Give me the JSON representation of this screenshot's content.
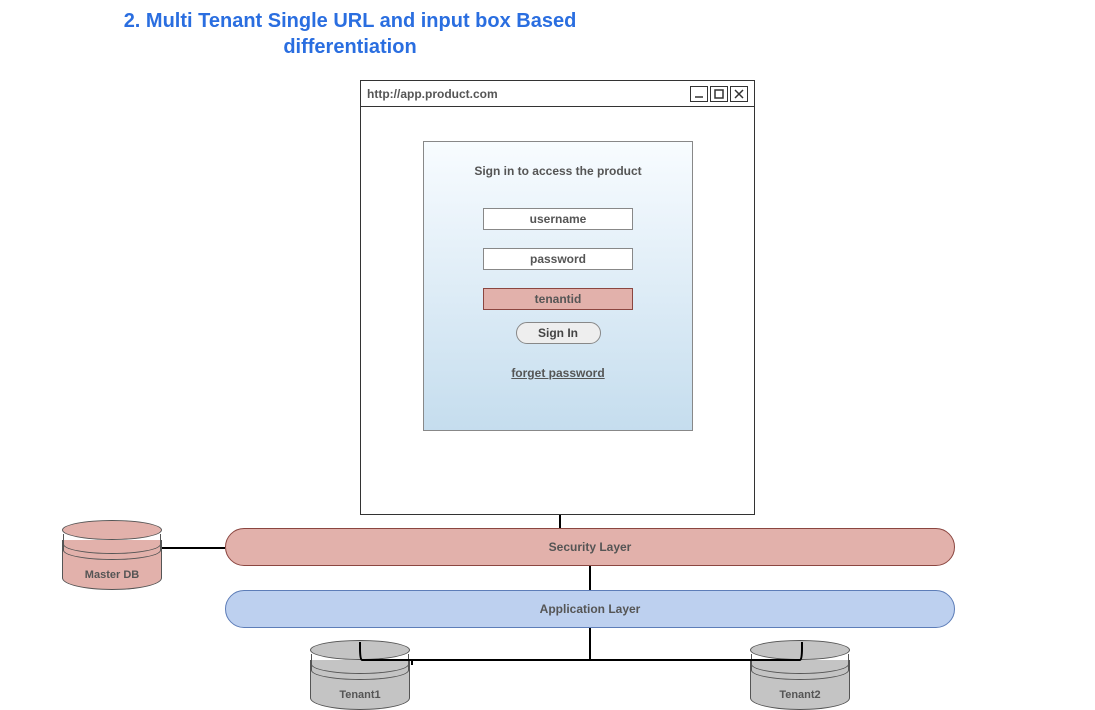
{
  "title": "2. Multi Tenant Single URL and input box Based differentiation",
  "browser": {
    "url": "http://app.product.com"
  },
  "login": {
    "heading": "Sign in to access the product",
    "username_placeholder": "username",
    "password_placeholder": "password",
    "tenant_placeholder": "tenantid",
    "signin_label": "Sign In",
    "forget_label": "forget password"
  },
  "layers": {
    "security": "Security Layer",
    "application": "Application Layer"
  },
  "databases": {
    "master": "Master DB",
    "tenant1": "Tenant1",
    "tenant2": "Tenant2"
  }
}
